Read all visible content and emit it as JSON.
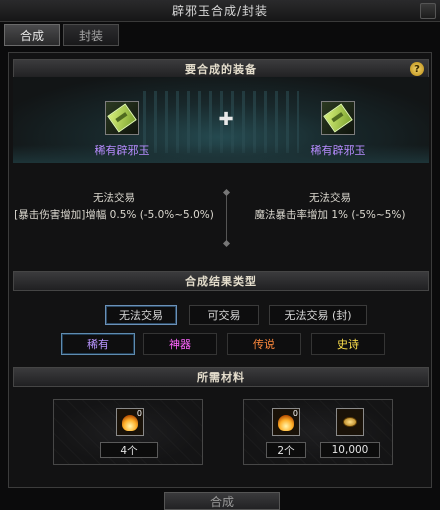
{
  "window": {
    "title": "辟邪玉合成/封装"
  },
  "tabs": [
    {
      "label": "合成"
    },
    {
      "label": "封装"
    }
  ],
  "sections": {
    "equip": "要合成的装备",
    "result_type": "合成结果类型",
    "materials": "所需材料"
  },
  "help": {
    "symbol": "?"
  },
  "plus_symbol": "✚",
  "items": [
    {
      "name": "稀有辟邪玉",
      "trade": "无法交易",
      "stat": "[暴击伤害增加]增幅 0.5% (-5.0%~5.0%)"
    },
    {
      "name": "稀有辟邪玉",
      "trade": "无法交易",
      "stat": "魔法暴击率增加 1% (-5%~5%)"
    }
  ],
  "trade_options": [
    {
      "label": "无法交易",
      "selected": true
    },
    {
      "label": "可交易",
      "selected": false
    },
    {
      "label": "无法交易 (封)",
      "selected": false
    }
  ],
  "rarity_options": [
    {
      "label": "稀有",
      "color": "#b995ff",
      "selected": true
    },
    {
      "label": "神器",
      "color": "#ff66ff",
      "selected": false
    },
    {
      "label": "传说",
      "color": "#ff8a3d",
      "selected": false
    },
    {
      "label": "史诗",
      "color": "#ffe14d",
      "selected": false
    }
  ],
  "materials": {
    "group1": {
      "count": "4个",
      "badge": "0",
      "icon": "flame-icon"
    },
    "group2": {
      "fire": {
        "count": "2个",
        "badge": "0",
        "icon": "flame-icon"
      },
      "gold": {
        "count": "10,000",
        "badge": "",
        "icon": "gold-coin-icon"
      }
    }
  },
  "combine_button": "合成",
  "colors": {
    "accent_rare": "#b78cff",
    "selected_border": "#6b91b8"
  }
}
